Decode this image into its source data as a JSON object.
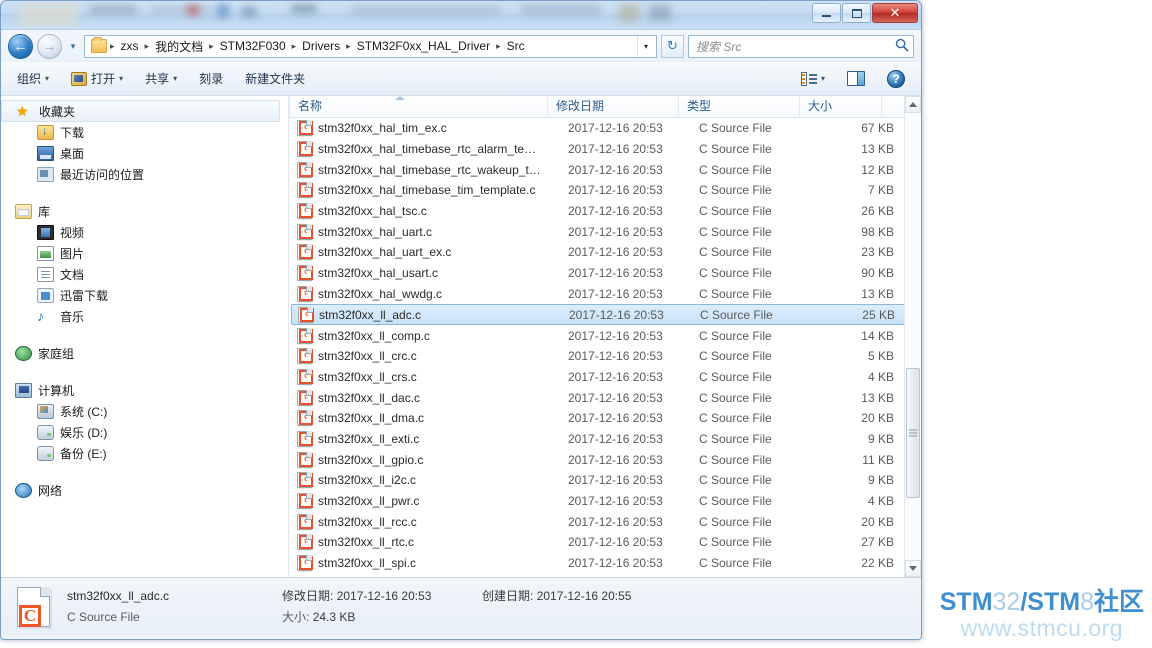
{
  "window": {
    "title": "",
    "buttons": {
      "minimize": "–",
      "maximize": "□",
      "close": "✕"
    }
  },
  "nav": {
    "back_label": "←",
    "forward_label": "→",
    "history_label": "▾",
    "breadcrumb": [
      "zxs",
      "我的文档",
      "STM32F030",
      "Drivers",
      "STM32F0xx_HAL_Driver",
      "Src"
    ],
    "breadcrumb_sep": "▸",
    "address_dropdown": "▾",
    "refresh_label": "↻",
    "search_placeholder": "搜索 Src",
    "search_value": "",
    "search_icon": "⚲"
  },
  "toolbar": {
    "organize": "组织",
    "open": "打开",
    "share": "共享",
    "burn": "刻录",
    "new_folder": "新建文件夹",
    "caret": "▾",
    "view_caret": "▾",
    "help": "?"
  },
  "sidebar": {
    "groups": [
      {
        "header": {
          "label": "收藏夹",
          "icon": "star-icon",
          "selected": true
        },
        "items": [
          {
            "label": "下载",
            "icon": "downloads-icon"
          },
          {
            "label": "桌面",
            "icon": "desktop-icon"
          },
          {
            "label": "最近访问的位置",
            "icon": "recent-places-icon"
          }
        ]
      },
      {
        "header": {
          "label": "库",
          "icon": "library-icon",
          "selected": false
        },
        "items": [
          {
            "label": "视频",
            "icon": "video-icon"
          },
          {
            "label": "图片",
            "icon": "pictures-icon"
          },
          {
            "label": "文档",
            "icon": "documents-icon"
          },
          {
            "label": "迅雷下载",
            "icon": "thunder-download-icon"
          },
          {
            "label": "音乐",
            "icon": "music-icon"
          }
        ]
      },
      {
        "header": {
          "label": "家庭组",
          "icon": "homegroup-icon",
          "selected": false
        },
        "items": []
      },
      {
        "header": {
          "label": "计算机",
          "icon": "computer-icon",
          "selected": false
        },
        "items": [
          {
            "label": "系统 (C:)",
            "icon": "system-drive-icon"
          },
          {
            "label": "娱乐 (D:)",
            "icon": "drive-icon"
          },
          {
            "label": "备份 (E:)",
            "icon": "drive-icon"
          }
        ]
      },
      {
        "header": {
          "label": "网络",
          "icon": "network-icon",
          "selected": false
        },
        "items": []
      }
    ]
  },
  "filelist": {
    "columns": [
      "名称",
      "修改日期",
      "类型",
      "大小"
    ],
    "sorted_column": "名称",
    "sort_direction": "asc",
    "rows": [
      {
        "name": "stm32f0xx_hal_tim_ex.c",
        "date": "2017-12-16 20:53",
        "type": "C Source File",
        "size": "67 KB",
        "selected": false
      },
      {
        "name": "stm32f0xx_hal_timebase_rtc_alarm_te…",
        "date": "2017-12-16 20:53",
        "type": "C Source File",
        "size": "13 KB",
        "selected": false
      },
      {
        "name": "stm32f0xx_hal_timebase_rtc_wakeup_t…",
        "date": "2017-12-16 20:53",
        "type": "C Source File",
        "size": "12 KB",
        "selected": false
      },
      {
        "name": "stm32f0xx_hal_timebase_tim_template.c",
        "date": "2017-12-16 20:53",
        "type": "C Source File",
        "size": "7 KB",
        "selected": false
      },
      {
        "name": "stm32f0xx_hal_tsc.c",
        "date": "2017-12-16 20:53",
        "type": "C Source File",
        "size": "26 KB",
        "selected": false
      },
      {
        "name": "stm32f0xx_hal_uart.c",
        "date": "2017-12-16 20:53",
        "type": "C Source File",
        "size": "98 KB",
        "selected": false
      },
      {
        "name": "stm32f0xx_hal_uart_ex.c",
        "date": "2017-12-16 20:53",
        "type": "C Source File",
        "size": "23 KB",
        "selected": false
      },
      {
        "name": "stm32f0xx_hal_usart.c",
        "date": "2017-12-16 20:53",
        "type": "C Source File",
        "size": "90 KB",
        "selected": false
      },
      {
        "name": "stm32f0xx_hal_wwdg.c",
        "date": "2017-12-16 20:53",
        "type": "C Source File",
        "size": "13 KB",
        "selected": false
      },
      {
        "name": "stm32f0xx_ll_adc.c",
        "date": "2017-12-16 20:53",
        "type": "C Source File",
        "size": "25 KB",
        "selected": true
      },
      {
        "name": "stm32f0xx_ll_comp.c",
        "date": "2017-12-16 20:53",
        "type": "C Source File",
        "size": "14 KB",
        "selected": false
      },
      {
        "name": "stm32f0xx_ll_crc.c",
        "date": "2017-12-16 20:53",
        "type": "C Source File",
        "size": "5 KB",
        "selected": false
      },
      {
        "name": "stm32f0xx_ll_crs.c",
        "date": "2017-12-16 20:53",
        "type": "C Source File",
        "size": "4 KB",
        "selected": false
      },
      {
        "name": "stm32f0xx_ll_dac.c",
        "date": "2017-12-16 20:53",
        "type": "C Source File",
        "size": "13 KB",
        "selected": false
      },
      {
        "name": "stm32f0xx_ll_dma.c",
        "date": "2017-12-16 20:53",
        "type": "C Source File",
        "size": "20 KB",
        "selected": false
      },
      {
        "name": "stm32f0xx_ll_exti.c",
        "date": "2017-12-16 20:53",
        "type": "C Source File",
        "size": "9 KB",
        "selected": false
      },
      {
        "name": "stm32f0xx_ll_gpio.c",
        "date": "2017-12-16 20:53",
        "type": "C Source File",
        "size": "11 KB",
        "selected": false
      },
      {
        "name": "stm32f0xx_ll_i2c.c",
        "date": "2017-12-16 20:53",
        "type": "C Source File",
        "size": "9 KB",
        "selected": false
      },
      {
        "name": "stm32f0xx_ll_pwr.c",
        "date": "2017-12-16 20:53",
        "type": "C Source File",
        "size": "4 KB",
        "selected": false
      },
      {
        "name": "stm32f0xx_ll_rcc.c",
        "date": "2017-12-16 20:53",
        "type": "C Source File",
        "size": "20 KB",
        "selected": false
      },
      {
        "name": "stm32f0xx_ll_rtc.c",
        "date": "2017-12-16 20:53",
        "type": "C Source File",
        "size": "27 KB",
        "selected": false
      },
      {
        "name": "stm32f0xx_ll_spi.c",
        "date": "2017-12-16 20:53",
        "type": "C Source File",
        "size": "22 KB",
        "selected": false
      }
    ]
  },
  "details": {
    "filename": "stm32f0xx_ll_adc.c",
    "modified_label": "修改日期:",
    "modified_value": "2017-12-16 20:53",
    "created_label": "创建日期:",
    "created_value": "2017-12-16 20:55",
    "type": "C Source File",
    "size_label": "大小:",
    "size_value": "24.3 KB"
  },
  "watermark": {
    "stm": "STM",
    "num32": "32",
    "slash": "/",
    "stm2": "STM",
    "num8": "8",
    "cn": "社区",
    "url": "www.stmcu.org"
  }
}
